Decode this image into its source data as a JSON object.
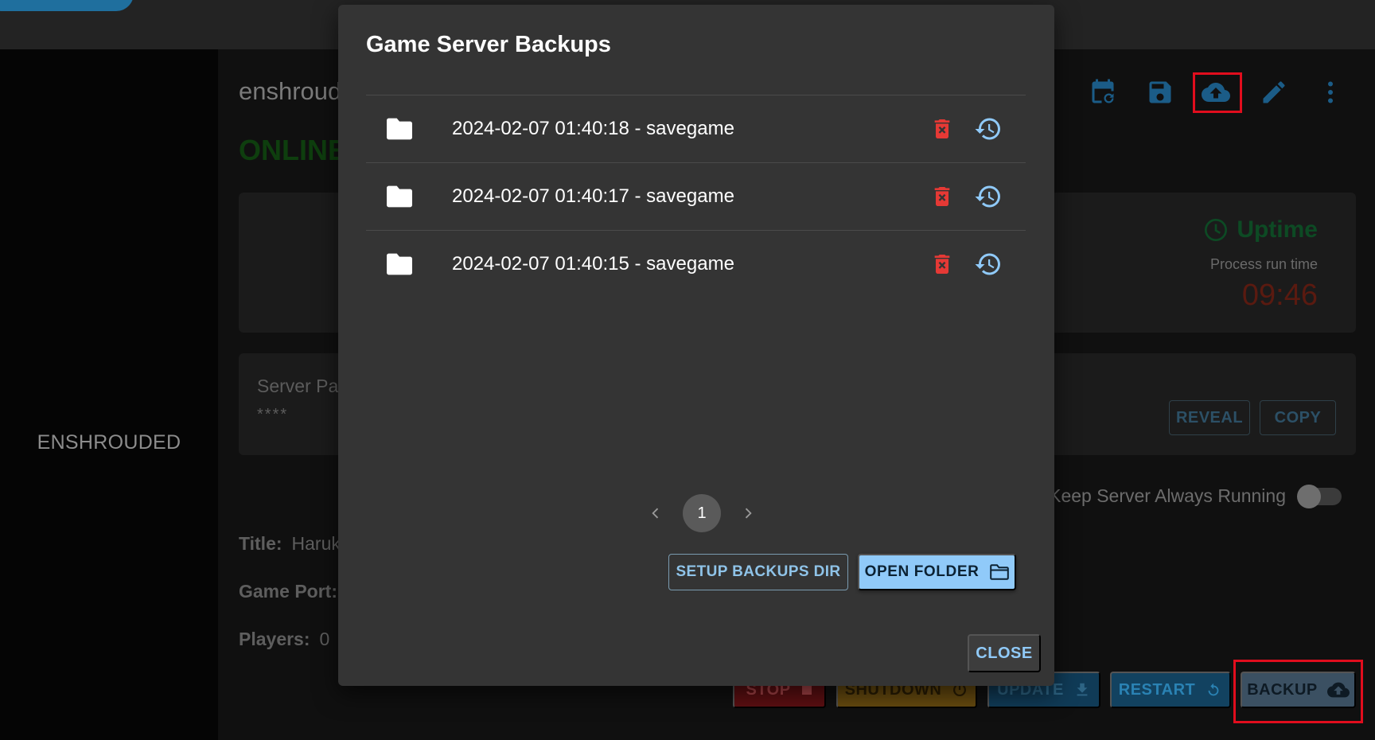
{
  "app": {
    "sidebar_label": "ENSHROUDED",
    "server_title": "enshrouded",
    "status": "ONLINE",
    "uptime": {
      "title": "Uptime",
      "subtitle": "Process run time",
      "value": "09:46"
    },
    "password": {
      "label": "Server Password",
      "value": "****",
      "reveal_label": "REVEAL",
      "copy_label": "COPY"
    },
    "keep_running_label": "Keep Server Always Running",
    "info": {
      "title_label": "Title:",
      "title_value": "Haruki",
      "port_label": "Game Port:",
      "players_label": "Players:",
      "players_value": "0"
    },
    "actions": {
      "stop": "STOP",
      "shutdown": "SHUTDOWN",
      "update": "UPDATE",
      "restart": "RESTART",
      "backup": "BACKUP"
    },
    "colors": {
      "highlight": "#e10d1d",
      "accent": "#90caf9",
      "danger": "#e53935"
    }
  },
  "dialog": {
    "title": "Game Server Backups",
    "backups": [
      {
        "name": "2024-02-07 01:40:18 - savegame"
      },
      {
        "name": "2024-02-07 01:40:17 - savegame"
      },
      {
        "name": "2024-02-07 01:40:15 - savegame"
      }
    ],
    "pagination": {
      "current_page": "1"
    },
    "setup_label": "SETUP BACKUPS DIR",
    "open_folder_label": "OPEN FOLDER",
    "close_label": "CLOSE"
  }
}
